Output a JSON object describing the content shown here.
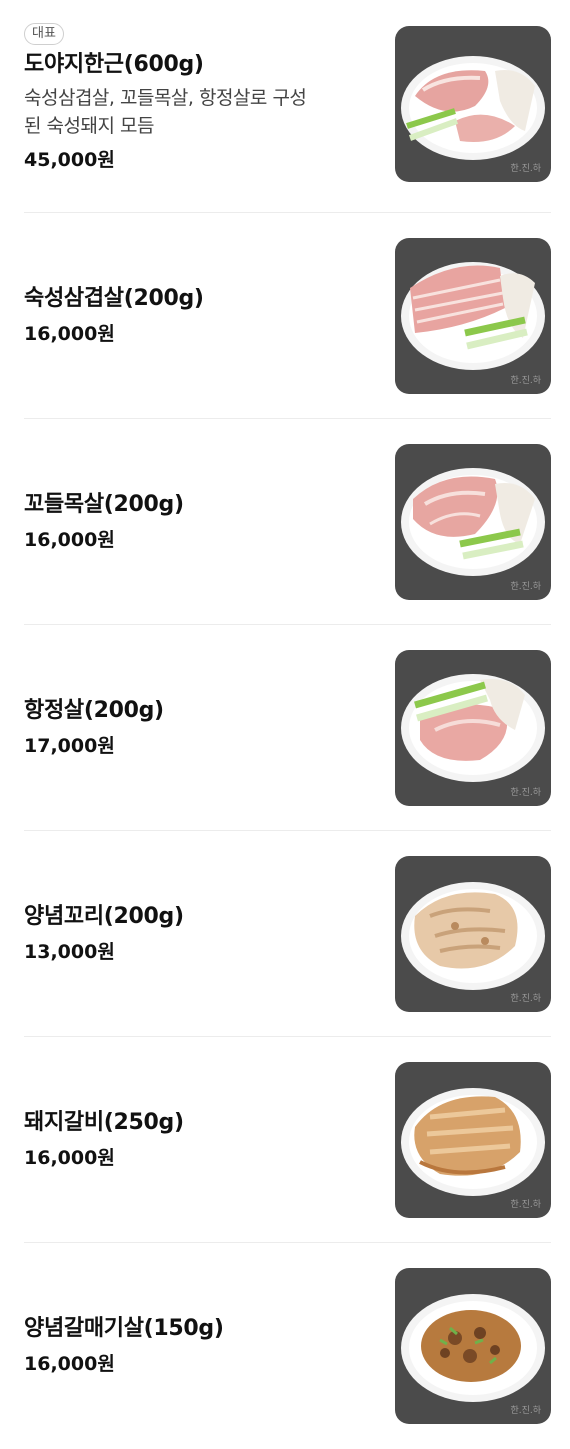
{
  "items": [
    {
      "badge": "대표",
      "name": "도야지한근(600g)",
      "desc_line1": "숙성삼겹살, 꼬들목살, 항정살로 구성",
      "desc_line2": "된 숙성돼지 모듬",
      "price": "45,000원",
      "photo": "pork-assortment",
      "watermark": "한.진.하"
    },
    {
      "name": "숙성삼겹살(200g)",
      "price": "16,000원",
      "photo": "pork-belly",
      "watermark": "한.진.하"
    },
    {
      "name": "꼬들목살(200g)",
      "price": "16,000원",
      "photo": "pork-neck",
      "watermark": "한.진.하"
    },
    {
      "name": "항정살(200g)",
      "price": "17,000원",
      "photo": "pork-jowl",
      "watermark": "한.진.하"
    },
    {
      "name": "양념꼬리(200g)",
      "price": "13,000원",
      "photo": "seasoned-tail",
      "watermark": "한.진.하"
    },
    {
      "name": "돼지갈비(250g)",
      "price": "16,000원",
      "photo": "pork-ribs",
      "watermark": "한.진.하"
    },
    {
      "name": "양념갈매기살(150g)",
      "price": "16,000원",
      "photo": "seasoned-skirt",
      "watermark": "한.진.하"
    }
  ],
  "colors": {
    "thumb_bg": "#4b4b4b",
    "plate": "#ffffff",
    "raw_meat": "#e9a7a4",
    "fat": "#f6e3df",
    "green_onion": "#8cc84b",
    "marinade": "#c98a45"
  }
}
